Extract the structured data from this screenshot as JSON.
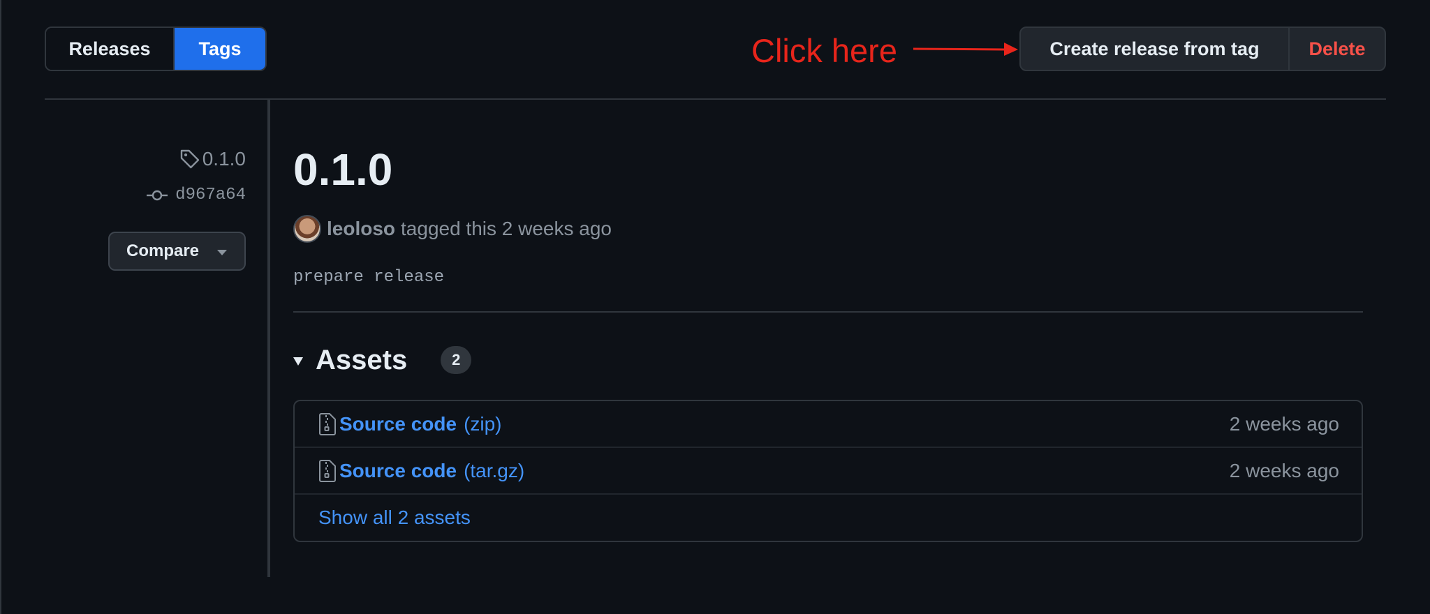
{
  "tabs": {
    "releases": "Releases",
    "tags": "Tags",
    "active": "Tags"
  },
  "annotation": {
    "text": "Click here",
    "color": "#e8251b"
  },
  "actions": {
    "create": "Create release from tag",
    "delete": "Delete"
  },
  "meta": {
    "tag": "0.1.0",
    "commit": "d967a64",
    "compare": "Compare"
  },
  "release": {
    "title": "0.1.0",
    "author": "leoloso",
    "tagged_text": "tagged this 2 weeks ago",
    "message": "prepare release"
  },
  "assets": {
    "title": "Assets",
    "count": "2",
    "items": [
      {
        "name": "Source code",
        "ext": "(zip)",
        "time": "2 weeks ago"
      },
      {
        "name": "Source code",
        "ext": "(tar.gz)",
        "time": "2 weeks ago"
      }
    ],
    "show_all": "Show all 2 assets"
  },
  "colors": {
    "accent": "#1f6feb",
    "link": "#4493f8",
    "danger": "#f85149",
    "background": "#0d1117"
  }
}
